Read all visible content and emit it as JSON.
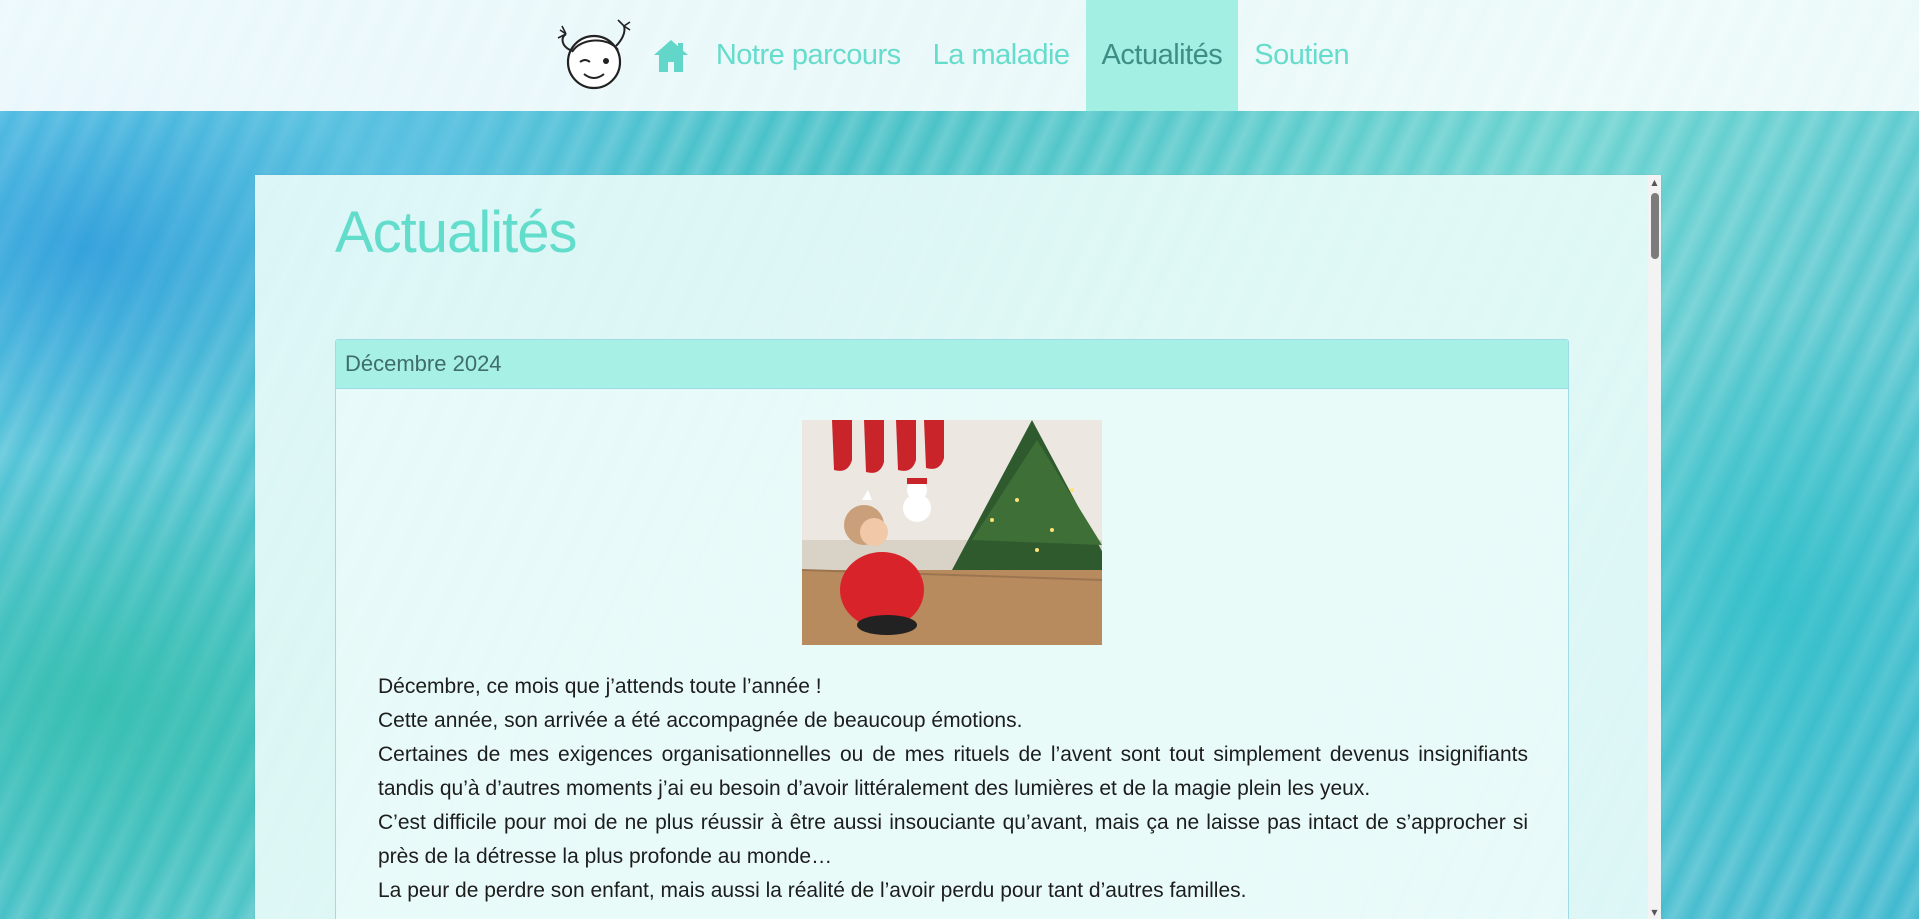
{
  "nav": {
    "logo_icon": "child-face-logo-icon",
    "home_icon": "home-icon",
    "items": [
      {
        "label": "Notre parcours"
      },
      {
        "label": "La maladie"
      },
      {
        "label": "Actualités",
        "active": true
      },
      {
        "label": "Soutien"
      }
    ],
    "accent_color": "#66dccc",
    "active_bg": "#a4efe4"
  },
  "main": {
    "title": "Actualités",
    "post": {
      "heading": "Décembre 2024",
      "photo_icon": "christmas-photo",
      "paragraphs": [
        "Décembre, ce mois que j’attends toute l’année !",
        "Cette année, son arrivée a été accompagnée de beaucoup émotions.",
        "Certaines de mes exigences organisationnelles ou de mes rituels de l’avent sont tout simplement devenus insignifiants tandis qu’à d’autres moments j’ai eu besoin d’avoir littéralement des lumières et de la magie plein les yeux.",
        "C’est difficile pour moi de ne plus réussir à être aussi insouciante qu’avant, mais ça ne laisse pas intact de s’approcher si près de la détresse la plus profonde au monde…",
        "La peur de perdre son enfant, mais aussi la réalité de l’avoir perdu pour tant d’autres familles."
      ]
    }
  }
}
